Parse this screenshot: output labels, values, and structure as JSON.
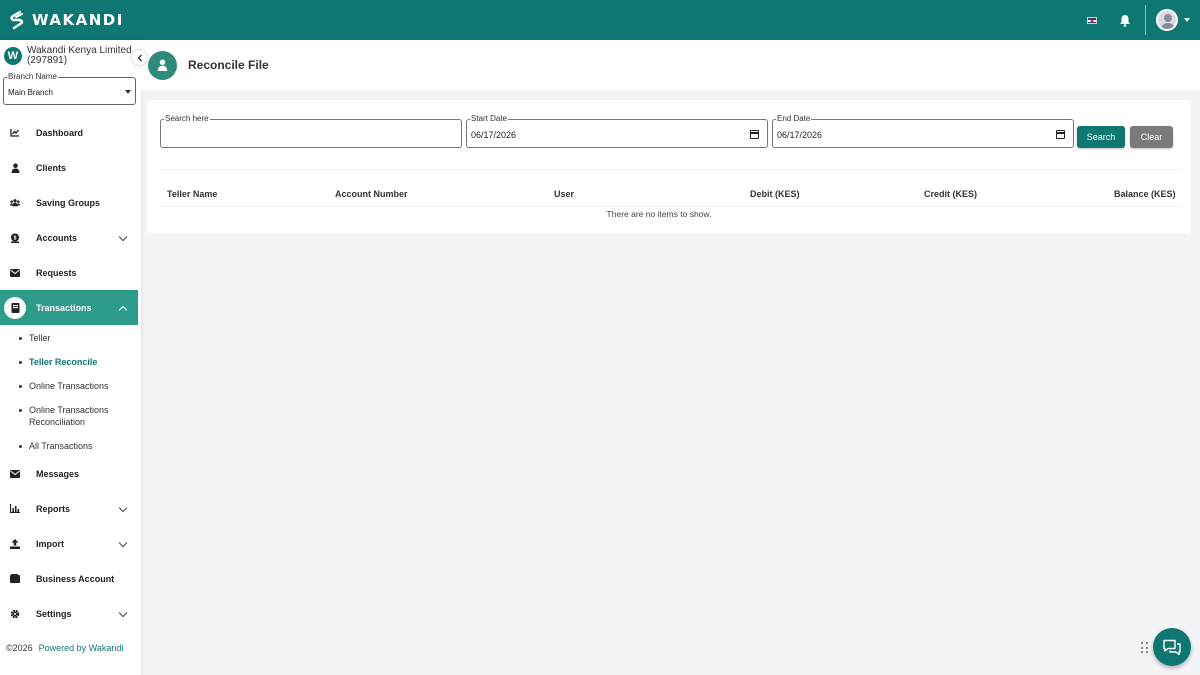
{
  "topbar": {
    "brand": "WAKANDI",
    "language_flag": "uk-flag-icon",
    "notification_icon": "bell-icon",
    "user_icon": "avatar-icon"
  },
  "sidebar": {
    "org_initial": "W",
    "org_name": "Wakandi Kenya Limited",
    "org_code": "(297891)",
    "branch_label": "Branch Name",
    "branch_value": "Main Branch",
    "items": [
      {
        "label": "Dashboard",
        "icon": "chart-line-icon"
      },
      {
        "label": "Clients",
        "icon": "user-icon"
      },
      {
        "label": "Saving Groups",
        "icon": "users-icon"
      },
      {
        "label": "Accounts",
        "icon": "bank-icon"
      },
      {
        "label": "Requests",
        "icon": "envelope-icon"
      },
      {
        "label": "Transactions",
        "icon": "book-icon"
      },
      {
        "label": "Messages",
        "icon": "envelope-icon"
      },
      {
        "label": "Reports",
        "icon": "chart-bar-icon"
      },
      {
        "label": "Import",
        "icon": "upload-icon"
      },
      {
        "label": "Business Account",
        "icon": "wallet-icon"
      },
      {
        "label": "Settings",
        "icon": "gear-icon"
      }
    ],
    "transaction_subitems": [
      "Teller",
      "Teller Reconcile",
      "Online Transactions",
      "Online Transactions Reconciliation",
      "All Transactions"
    ],
    "footer_copyright": "©2026",
    "footer_powered": "Powered by Wakandi"
  },
  "header": {
    "title": "Reconcile File"
  },
  "filters": {
    "search_label": "Search here",
    "search_value": "",
    "start_label": "Start Date",
    "start_value": "06/17/2026",
    "end_label": "End Date",
    "end_value": "06/17/2026",
    "search_button": "Search",
    "clear_button": "Clear"
  },
  "table": {
    "columns": [
      "Teller Name",
      "Account Number",
      "User",
      "Debit  (KES)",
      "Credit  (KES)",
      "Balance  (KES)"
    ],
    "empty_message": "There are no items to show."
  },
  "colors": {
    "primary": "#0f7771",
    "active_nav": "#2e9c8a",
    "clear_button": "#7a7a7a"
  }
}
